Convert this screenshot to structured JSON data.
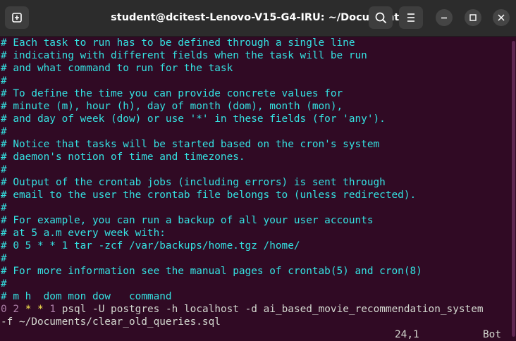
{
  "window": {
    "title": "student@dcitest-Lenovo-V15-G4-IRU: ~/Documents"
  },
  "icons": {
    "new_tab": "new-tab-icon",
    "search": "search-icon",
    "menu": "hamburger-menu-icon",
    "minimize": "minimize-icon",
    "maximize": "maximize-icon",
    "close": "close-icon"
  },
  "colors": {
    "background": "#300a24",
    "comment": "#34e2e2",
    "text": "#d3d7cf",
    "number": "#ad7fa8",
    "star": "#fce94f"
  },
  "editor": {
    "comment_lines": [
      "# Each task to run has to be defined through a single line",
      "# indicating with different fields when the task will be run",
      "# and what command to run for the task",
      "#",
      "# To define the time you can provide concrete values for",
      "# minute (m), hour (h), day of month (dom), month (mon),",
      "# and day of week (dow) or use '*' in these fields (for 'any').",
      "#",
      "# Notice that tasks will be started based on the cron's system",
      "# daemon's notion of time and timezones.",
      "#",
      "# Output of the crontab jobs (including errors) is sent through",
      "# email to the user the crontab file belongs to (unless redirected).",
      "#",
      "# For example, you can run a backup of all your user accounts",
      "# at 5 a.m every week with:",
      "# 0 5 * * 1 tar -zcf /var/backups/home.tgz /home/",
      "#",
      "# For more information see the manual pages of crontab(5) and cron(8)",
      "#",
      "# m h  dom mon dow   command"
    ],
    "cron_entry": {
      "minute": "0",
      "hour": "2",
      "day_of_month": "*",
      "month": "*",
      "day_of_week": "1",
      "command_part1": "psql -U postgres -h localhost -d ai_based_movie_recommendation_system",
      "command_part2": "-f ~/Documents/clear_old_queries.sql"
    },
    "cursor_position": "24,1",
    "scroll_position": "Bot"
  }
}
